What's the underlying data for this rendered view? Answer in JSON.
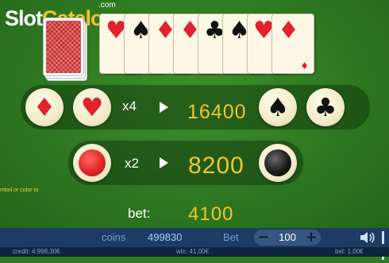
{
  "logo": {
    "part1": "Slot",
    "part2": "Catalog",
    "suffix": ".com"
  },
  "history_cards": [
    {
      "suit": "hearts",
      "glyph": "♥",
      "color": "red"
    },
    {
      "suit": "spades",
      "glyph": "♠",
      "color": "black"
    },
    {
      "suit": "diamonds",
      "glyph": "♦",
      "color": "red"
    },
    {
      "suit": "diamonds",
      "glyph": "♦",
      "color": "red"
    },
    {
      "suit": "clubs",
      "glyph": "♣",
      "color": "black"
    },
    {
      "suit": "spades",
      "glyph": "♠",
      "color": "black"
    },
    {
      "suit": "hearts",
      "glyph": "♥",
      "color": "red"
    },
    {
      "suit": "diamonds",
      "glyph": "♦",
      "color": "red"
    }
  ],
  "suit_row": {
    "options": [
      {
        "name": "diamond",
        "glyph": "♦",
        "color": "red"
      },
      {
        "name": "heart",
        "glyph": "♥",
        "color": "red"
      },
      {
        "name": "spade",
        "glyph": "♠",
        "color": "black"
      },
      {
        "name": "club",
        "glyph": "♣",
        "color": "black"
      }
    ],
    "multiplier": "x4",
    "payout": "16400"
  },
  "color_row": {
    "options": [
      {
        "name": "red",
        "color": "#e0262a"
      },
      {
        "name": "black",
        "color": "#1c1c1c"
      }
    ],
    "multiplier": "x2",
    "payout": "8200"
  },
  "hint_text": "mbol or color to",
  "bet": {
    "label": "bet:",
    "value": "4100"
  },
  "bottom_bar": {
    "coins_label": "coins",
    "coins_value": "499830",
    "bet_label": "Bet",
    "bet_value": "100",
    "minus": "−",
    "plus": "+"
  },
  "footer": {
    "credit": "credit: 4.998,30€",
    "win": "win: 41,00€",
    "bet": "bet: 1,00€"
  },
  "colors": {
    "felt": "#2f7a22",
    "gold": "#f2c530",
    "bar": "#1d3c63"
  }
}
